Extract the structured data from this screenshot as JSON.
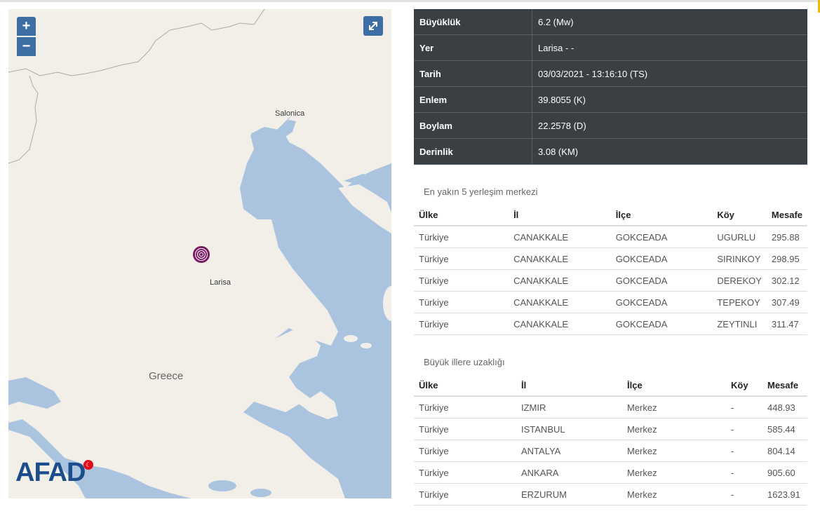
{
  "map": {
    "zoom_in": "+",
    "zoom_out": "−",
    "cities": {
      "salonica": "Salonica",
      "larisa": "Larisa"
    },
    "country": "Greece",
    "logo": "AFAD",
    "expand_icon": "expand-icon",
    "quake_icon": "epicenter-icon",
    "colors": {
      "land": "#f2efe9",
      "sea": "#aac4df",
      "control": "#3d6fa5",
      "epicenter": "#7b1a64"
    }
  },
  "info": [
    {
      "key": "Büyüklük",
      "value": "6.2 (Mw)"
    },
    {
      "key": "Yer",
      "value": "Larisa - -"
    },
    {
      "key": "Tarih",
      "value": "03/03/2021 - 13:16:10 (TS)"
    },
    {
      "key": "Enlem",
      "value": "39.8055 (K)"
    },
    {
      "key": "Boylam",
      "value": "22.2578 (D)"
    },
    {
      "key": "Derinlik",
      "value": "3.08 (KM)"
    }
  ],
  "nearest": {
    "title": "En yakın 5 yerleşim merkezi",
    "headers": [
      "Ülke",
      "İl",
      "İlçe",
      "Köy",
      "Mesafe"
    ],
    "rows": [
      [
        "Türkiye",
        "CANAKKALE",
        "GOKCEADA",
        "UGURLU",
        "295.88"
      ],
      [
        "Türkiye",
        "CANAKKALE",
        "GOKCEADA",
        "SIRINKOY",
        "298.95"
      ],
      [
        "Türkiye",
        "CANAKKALE",
        "GOKCEADA",
        "DEREKOY",
        "302.12"
      ],
      [
        "Türkiye",
        "CANAKKALE",
        "GOKCEADA",
        "TEPEKOY",
        "307.49"
      ],
      [
        "Türkiye",
        "CANAKKALE",
        "GOKCEADA",
        "ZEYTINLI",
        "311.47"
      ]
    ]
  },
  "cities": {
    "title": "Büyük illere uzaklığı",
    "headers": [
      "Ülke",
      "İl",
      "İlçe",
      "Köy",
      "Mesafe"
    ],
    "rows": [
      [
        "Türkiye",
        "IZMIR",
        "Merkez",
        "-",
        "448.93"
      ],
      [
        "Türkiye",
        "ISTANBUL",
        "Merkez",
        "-",
        "585.44"
      ],
      [
        "Türkiye",
        "ANTALYA",
        "Merkez",
        "-",
        "804.14"
      ],
      [
        "Türkiye",
        "ANKARA",
        "Merkez",
        "-",
        "905.60"
      ],
      [
        "Türkiye",
        "ERZURUM",
        "Merkez",
        "-",
        "1623.91"
      ]
    ]
  }
}
